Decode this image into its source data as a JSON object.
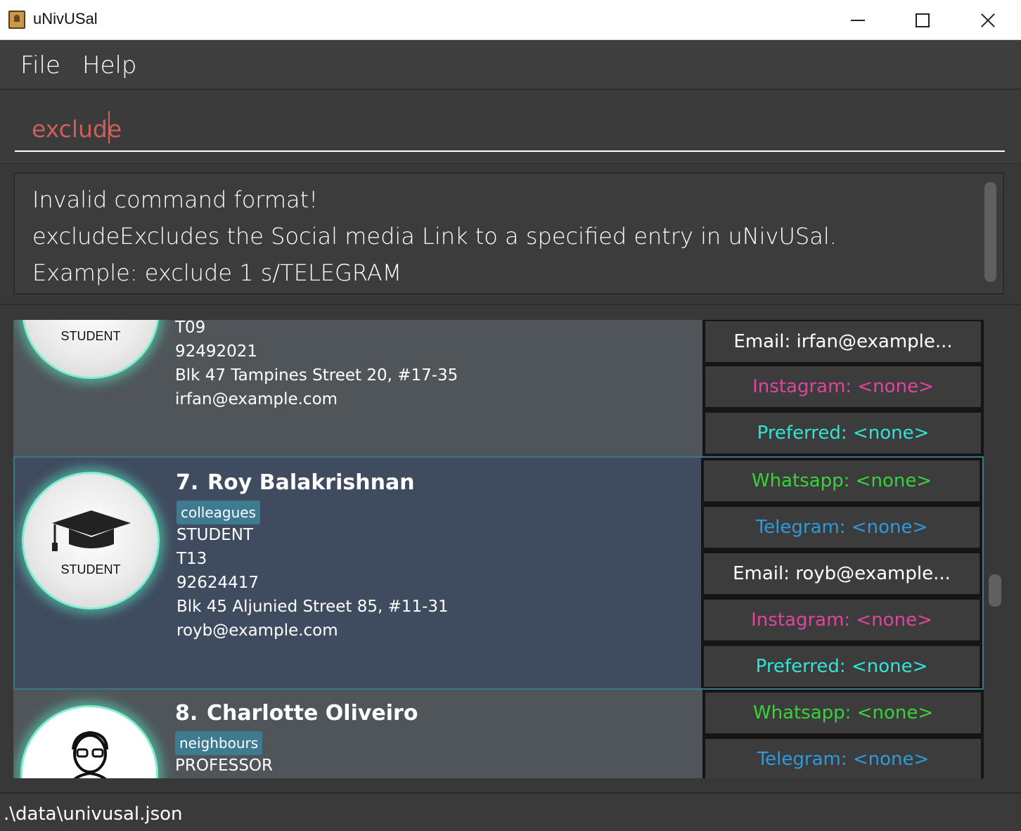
{
  "window": {
    "title": "uNivUSal"
  },
  "menu": {
    "file": "File",
    "help": "Help"
  },
  "command": {
    "value": "exclude"
  },
  "result": {
    "lines": [
      "Invalid command format!",
      "excludeExcludes the Social media Link to a specified entry in uNivUSal.",
      "Example: exclude 1 s/TELEGRAM"
    ]
  },
  "persons": [
    {
      "avatar_label": "STUDENT",
      "fields": [
        "T09",
        "92492021",
        "Blk 47 Tampines Street 20, #17-35",
        "irfan@example.com"
      ],
      "socials": [
        {
          "label": "Email: irfan@example...",
          "color": "#ffffff"
        },
        {
          "label": "Instagram: <none>",
          "color": "#e0449e"
        },
        {
          "label": "Preferred: <none>",
          "color": "#2ee6d6"
        }
      ]
    },
    {
      "index": "7.",
      "name": "Roy Balakrishnan",
      "tag": "colleagues",
      "avatar_label": "STUDENT",
      "fields": [
        "STUDENT",
        "T13",
        "92624417",
        "Blk 45 Aljunied Street 85, #11-31",
        "royb@example.com"
      ],
      "socials": [
        {
          "label": "Whatsapp: <none>",
          "color": "#36d43a"
        },
        {
          "label": "Telegram: <none>",
          "color": "#2a9be0"
        },
        {
          "label": "Email: royb@example...",
          "color": "#ffffff"
        },
        {
          "label": "Instagram: <none>",
          "color": "#e0449e"
        },
        {
          "label": "Preferred: <none>",
          "color": "#2ee6d6"
        }
      ]
    },
    {
      "index": "8.",
      "name": "Charlotte Oliveiro",
      "tag": "neighbours",
      "fields": [
        "PROFESSOR"
      ],
      "socials": [
        {
          "label": "Whatsapp: <none>",
          "color": "#36d43a"
        },
        {
          "label": "Telegram: <none>",
          "color": "#2a9be0"
        }
      ]
    }
  ],
  "status": {
    "path": ".\\data\\univusal.json"
  },
  "icons": [
    "app-icon",
    "minimize-icon",
    "maximize-icon",
    "close-icon",
    "graduation-cap-icon",
    "professor-icon"
  ]
}
